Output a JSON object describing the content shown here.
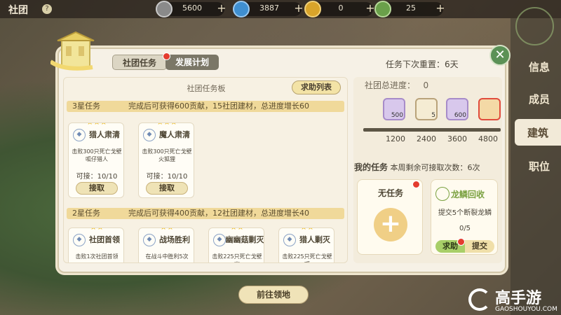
{
  "header": {
    "title": "社团",
    "help": "?",
    "resources": [
      {
        "icon": "silver-coin-icon",
        "value": "5600"
      },
      {
        "icon": "blue-gem-icon",
        "value": "3887"
      },
      {
        "icon": "gold-token-icon",
        "value": "0"
      },
      {
        "icon": "green-token-icon",
        "value": "25"
      }
    ]
  },
  "nav": {
    "items": [
      {
        "label": "信息"
      },
      {
        "label": "成员"
      },
      {
        "label": "建筑"
      },
      {
        "label": "职位"
      }
    ],
    "active": 2
  },
  "panel": {
    "tabs": [
      "社团任务",
      "发展计划"
    ],
    "reset_text": "任务下次重置：6天",
    "close": "✕"
  },
  "board": {
    "title": "社团任务板",
    "help_button": "求助列表",
    "tiers": [
      {
        "name": "3星任务",
        "desc": "完成后可获得600贡献，15社团建材，总进度增长60",
        "stars": "★★★",
        "cards": [
          {
            "name": "猎人肃清",
            "desc": "击败300只死亡戈壁呱仔猎人",
            "progress": "可接：10/10",
            "button": "接取"
          },
          {
            "name": "魔人肃清",
            "desc": "击败300只死亡戈壁火狐狸",
            "progress": "可接：10/10",
            "button": "接取"
          }
        ]
      },
      {
        "name": "2星任务",
        "desc": "完成后可获得400贡献，12社团建材，总进度增长40",
        "stars": "★★",
        "cards": [
          {
            "name": "社团首领",
            "desc": "击败1次社团首领"
          },
          {
            "name": "战场胜利",
            "desc": "在战斗中胜利5次"
          },
          {
            "name": "幽幽菇剿灭",
            "desc": "击败225只死亡戈壁幽"
          },
          {
            "name": "猎人剿灭",
            "desc": "击败225只死亡戈壁呱"
          }
        ]
      }
    ]
  },
  "progress": {
    "label": "社团总进度：",
    "value": "0",
    "rewards": [
      {
        "icon": "silver-medal-icon",
        "count": "500"
      },
      {
        "icon": "scroll-icon",
        "count": "5"
      },
      {
        "icon": "silver-medal-icon",
        "count": "600"
      },
      {
        "icon": "book-icon",
        "count": ""
      }
    ],
    "ticks": [
      "1200",
      "2400",
      "3600",
      "4800"
    ],
    "fill_fraction": 0
  },
  "mytasks": {
    "label": "我的任务",
    "remaining": "本周剩余可接取次数：6次",
    "empty_label": "无任务",
    "dragon": {
      "name": "龙鳞回收",
      "desc": "提交5个断裂龙鳞",
      "progress": "0/5",
      "help_btn": "求助",
      "submit_btn": "提交"
    }
  },
  "footer": {
    "go_button": "前往领地"
  },
  "watermark": {
    "text": "高手游",
    "url": "GAOSHOUYOU.COM"
  }
}
